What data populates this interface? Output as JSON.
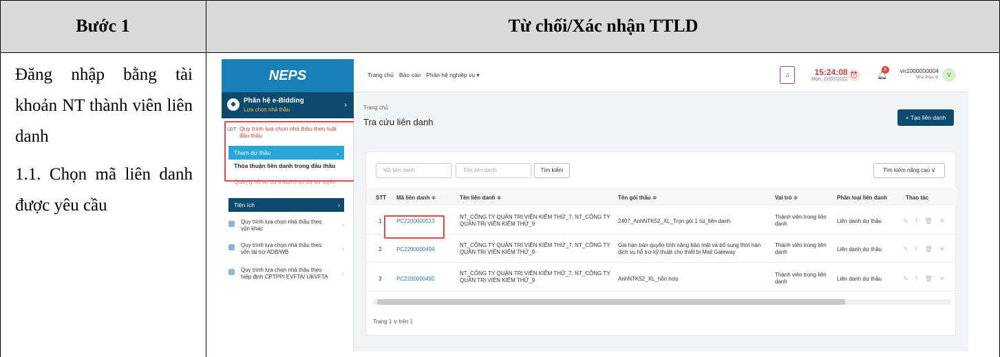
{
  "header": {
    "step_label": "Bước 1",
    "action_title": "Từ chối/Xác nhận TTLD"
  },
  "instructions": {
    "line1": "Đăng nhập bằng tài khoản NT thành viên liên danh",
    "line2": "1.1. Chọn mã liên danh được yêu cầu"
  },
  "screenshot": {
    "logo": "NEPS",
    "module": {
      "title": "Phân hệ e-Bidding",
      "subtitle": "Lựa chọn nhà thầu"
    },
    "sidebar": {
      "law_item": "Quy trình lựa chọn nhà thầu theo luật đấu thầu",
      "tham_du_thau": "Tham dự thầu",
      "sub_active_item": "Thỏa thuận liên danh trong đấu thầu",
      "sub_item_faded": "Quản lý hồ sơ dự thầu/hồ sơ dự sơ tuyển",
      "tien_ich": "Tiện ích",
      "other1": "Quy trình lựa chọn nhà thầu theo vốn khác",
      "other2": "Quy trình lựa chọn nhà thầu theo vốn tài trợ ADB/WB",
      "other3": "Quy trình lựa chọn nhà thầu theo hiệp định CPTPP/ EVFTA/ UKVFTA"
    },
    "topnav": {
      "home": "Trang chủ",
      "report": "Báo cáo",
      "modules": "Phân hệ nghiệp vụ ▾"
    },
    "clock": {
      "time": "15:24:08",
      "date": "Mon, 22/07/2022"
    },
    "notifications": "9",
    "user": {
      "id": "vn1000000004",
      "role": "Nhà thầu ⊘",
      "avatar": "V"
    },
    "breadcrumb": "Trang chủ",
    "page_title": "Tra cứu liên danh",
    "new_button": "+ Tạo liên danh",
    "search": {
      "code_placeholder": "Mã liên danh",
      "name_placeholder": "Tên liên danh",
      "search_button": "Tìm kiếm",
      "advanced_button": "Tìm kiếm nâng cao ∨"
    },
    "table": {
      "headers": [
        "STT",
        "Mã liên danh ≑",
        "Tên liên danh ≑",
        "Tên gói thầu ≑",
        "Vai trò ≑",
        "Phân loại liên danh",
        "Thao tác"
      ],
      "rows": [
        {
          "stt": "1",
          "code": "PC2200000513",
          "name": "NT_CÔNG TY QUẢN TRỊ VIÊN KIỂM THỬ_7, NT_CÔNG TY QUẢN TRỊ VIÊN KIỂM THỬ_9",
          "package": "2407_AnhNTK52_XL_Trọn gói 1 túi_liên danh",
          "role": "Thành viên trong liên danh",
          "type": "Liên danh dự thầu"
        },
        {
          "stt": "2",
          "code": "PC2200000494",
          "name": "NT_CÔNG TY QUẢN TRỊ VIÊN KIỂM THỬ_7, NT_CÔNG TY QUẢN TRỊ VIÊN KIỂM THỬ_9",
          "package": "Gia hạn bản quyền tính năng bảo mật và bổ sung thời hạn dịch vụ hỗ trợ kỹ thuật cho thiết bị Mail Gateway",
          "role": "Thành viên trong liên danh",
          "type": "Liên danh dự thầu"
        },
        {
          "stt": "3",
          "code": "PC2200000492",
          "name": "NT_CÔNG TY QUẢN TRỊ VIÊN KIỂM THỬ_7, NT_CÔNG TY QUẢN TRỊ VIÊN KIỂM THỬ_9",
          "package": "AnhNTK52_XL_hỗn hợp",
          "role": "Thành viên trong liên danh",
          "type": "Liên danh dự thầu"
        }
      ]
    },
    "pager": "Trang  1  ∨  trên 1"
  }
}
